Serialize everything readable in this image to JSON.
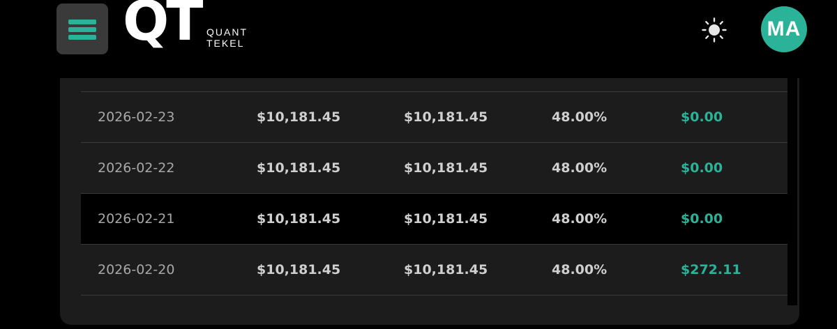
{
  "header": {
    "menu_icon": "hamburger-menu-icon",
    "logo": {
      "mark": "QT",
      "line1": "QUANT",
      "line2": "TEKEL"
    },
    "theme_icon": "sun-icon",
    "avatar_initials": "MA"
  },
  "colors": {
    "accent": "#2bb39a",
    "background": "#000000",
    "card": "#1c1c1c"
  },
  "table": {
    "rows": [
      {
        "date": "2026-02-23",
        "col1": "$10,181.45",
        "col2": "$10,181.45",
        "pct": "48.00%",
        "amount": "$0.00",
        "highlighted": false
      },
      {
        "date": "2026-02-22",
        "col1": "$10,181.45",
        "col2": "$10,181.45",
        "pct": "48.00%",
        "amount": "$0.00",
        "highlighted": false
      },
      {
        "date": "2026-02-21",
        "col1": "$10,181.45",
        "col2": "$10,181.45",
        "pct": "48.00%",
        "amount": "$0.00",
        "highlighted": true
      },
      {
        "date": "2026-02-20",
        "col1": "$10,181.45",
        "col2": "$10,181.45",
        "pct": "48.00%",
        "amount": "$272.11",
        "highlighted": false
      }
    ]
  }
}
